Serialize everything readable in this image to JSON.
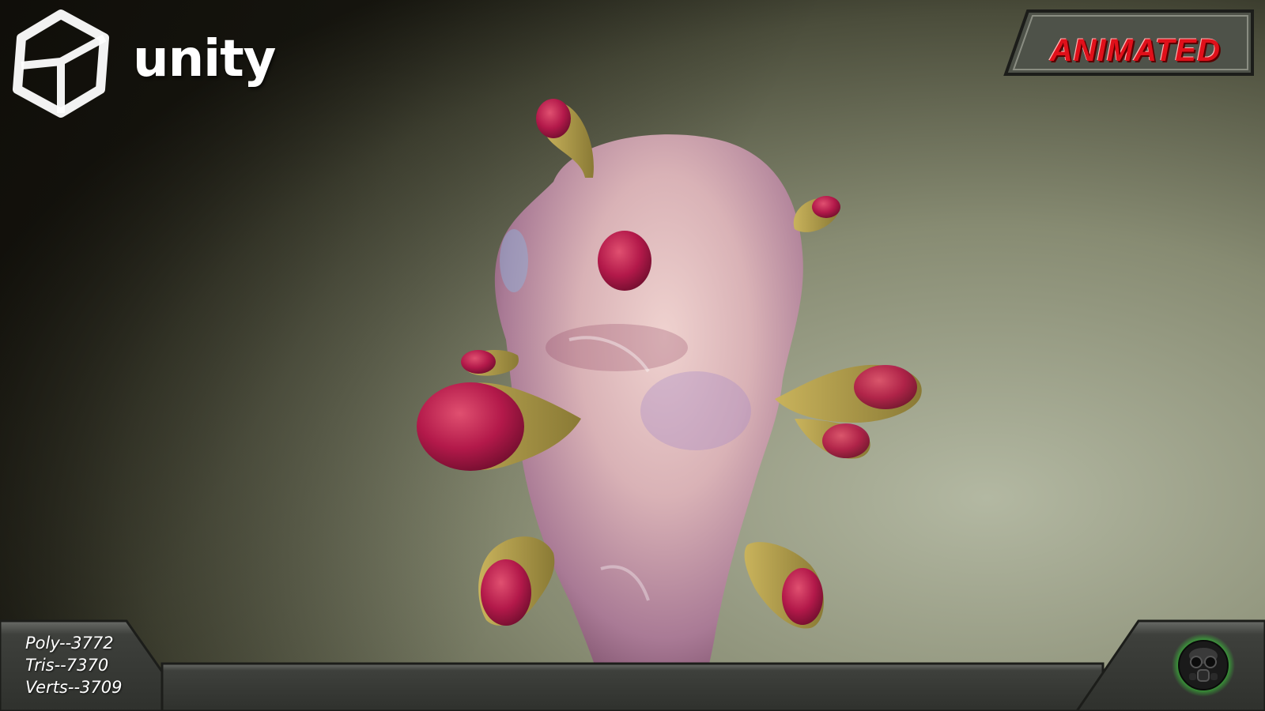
{
  "brand": {
    "name": "unity"
  },
  "badge": {
    "label": "ANIMATED"
  },
  "stats": [
    {
      "label": "Poly--3772"
    },
    {
      "label": "Tris--7370"
    },
    {
      "label": "Verts--3709"
    }
  ],
  "icons": {
    "logo": "unity-cube-icon",
    "avatar": "gas-mask-icon"
  },
  "colors": {
    "badge_text": "#e0101a",
    "avatar_glow": "#3cff3c",
    "bar": "#4a4c49"
  }
}
